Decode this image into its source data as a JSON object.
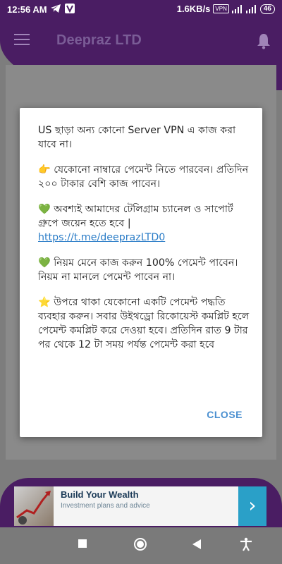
{
  "status_bar": {
    "time": "12:56 AM",
    "speed": "1.6KB/s",
    "vpn": "VPN",
    "battery": "46"
  },
  "app_bar": {
    "title": "Deepraz LTD"
  },
  "dialog": {
    "p1": "US ছাড়া অন্য কোনো Server VPN এ কাজ করা যাবে না।",
    "p2_icon": "👉",
    "p2": "যেকোনো নাম্বারে পেমেন্ট নিতে পারবেন। প্রতিদিন ২০০ টাকার বেশি কাজ পাবেন।",
    "p3_icon": "💚",
    "p3": "অবশ্যই আমাদের টেলিগ্রাম চ্যানেল ও সাপোর্ট গ্রুপে জয়েন হতে হবে |",
    "p3_link": "https://t.me/deeprazLTD0",
    "p4_icon": "💚",
    "p4": "নিয়ম মেনে কাজ করুন 100% পেমেন্ট পাবেন। নিয়ম না মানলে পেমেন্ট পাবেন না।",
    "p5_icon": "⭐",
    "p5": "উপরে থাকা যেকোনো একটি পেমেন্ট পদ্ধতি ব্যবহার করুন। সবার উইথড্রো রিকোয়েস্ট কমপ্লিট হলে পেমেন্ট কমপ্লিট করে দেওয়া হবে। প্রতিদিন রাত 9 টার পর থেকে 12 টা সময় পর্যন্ত পেমেন্ট করা হবে",
    "close_label": "CLOSE"
  },
  "ad": {
    "title": "Build Your Wealth",
    "subtitle": "Investment plans and advice",
    "arrow": "›"
  },
  "colors": {
    "primary": "#4a1d63",
    "link": "#2a7cc7",
    "close": "#4a8fd0"
  }
}
